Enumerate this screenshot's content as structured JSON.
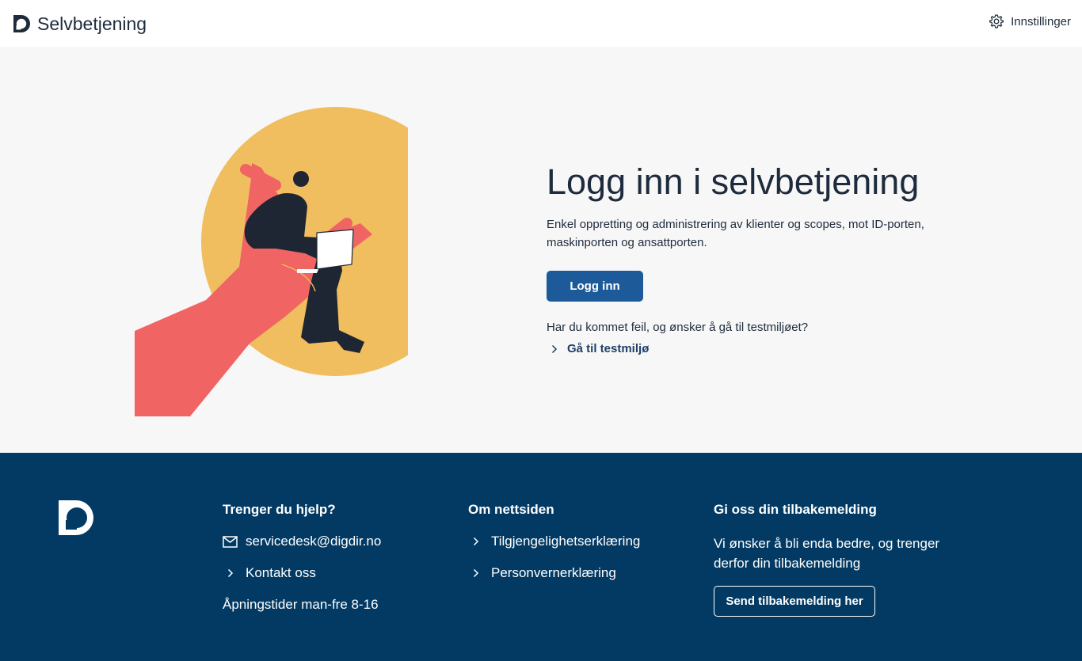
{
  "header": {
    "brand_title": "Selvbetjening",
    "brand_icon": "digdir-logo-icon",
    "settings_label": "Innstillinger",
    "settings_icon": "gear-icon"
  },
  "main": {
    "title": "Logg inn i selvbetjening",
    "description": "Enkel oppretting og administrering av klienter og scopes, mot ID-porten, maskinporten og ansattporten.",
    "login_button": "Logg inn",
    "test_question": "Har du kommet feil, og ønsker å gå til testmiljøet?",
    "test_link": "Gå til testmiljø"
  },
  "footer": {
    "help": {
      "heading": "Trenger du hjelp?",
      "email": "servicedesk@digdir.no",
      "contact": "Kontakt oss",
      "hours": "Åpningstider man-fre 8-16"
    },
    "about": {
      "heading": "Om nettsiden",
      "accessibility": "Tilgjengelighetserklæring",
      "privacy": "Personvernerklæring"
    },
    "feedback": {
      "heading": "Gi oss din tilbakemelding",
      "text": "Vi ønsker å bli enda bedre, og trenger derfor din tilbakemelding",
      "button": "Send tilbakemelding her"
    }
  },
  "colors": {
    "primary_button": "#1c5a9a",
    "footer_background": "#033a63",
    "page_background": "#f7f7f7",
    "illustration_circle": "#f0bd5f",
    "illustration_hand": "#f06464",
    "illustration_figure": "#1e2533"
  }
}
